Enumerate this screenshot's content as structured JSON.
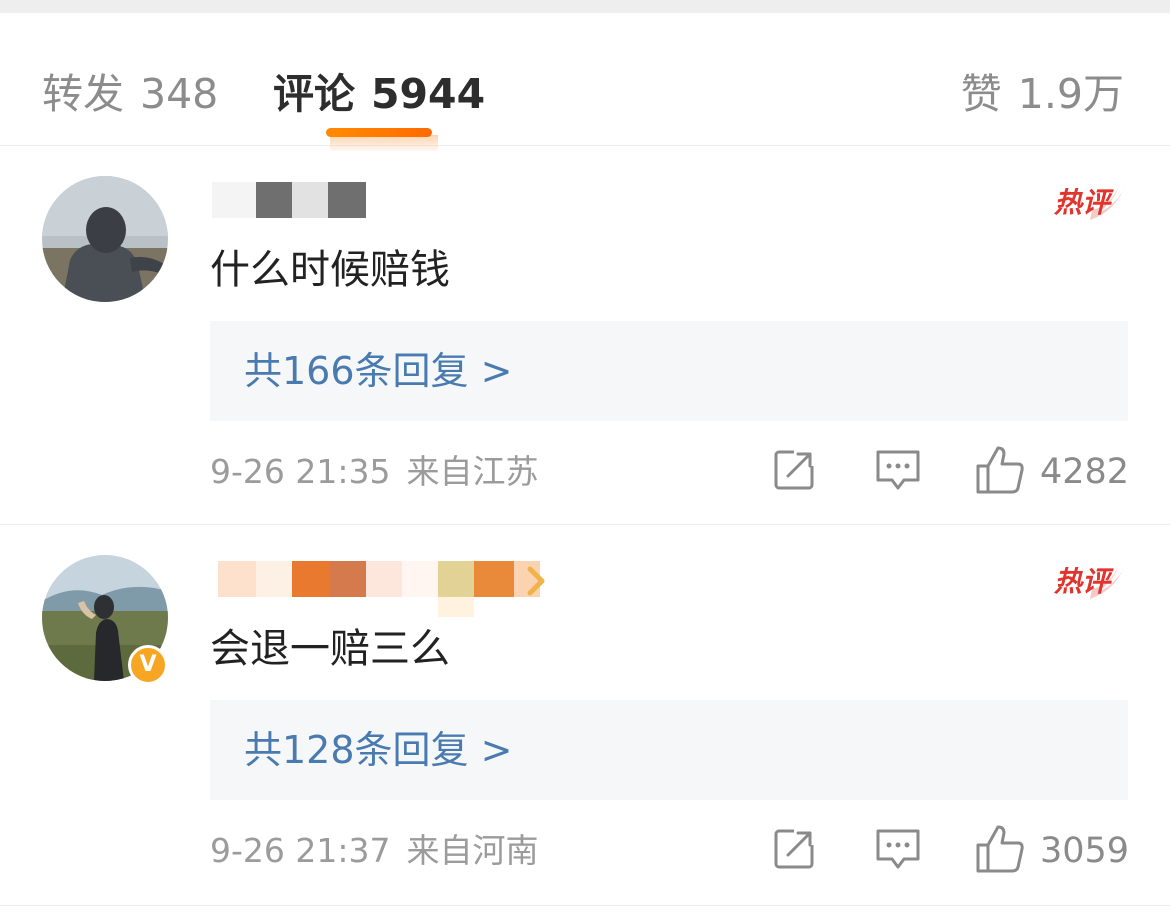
{
  "tabs": {
    "repost": {
      "label": "转发",
      "count": "348"
    },
    "comment": {
      "label": "评论",
      "count": "5944"
    },
    "likes": {
      "label": "赞",
      "count": "1.9万"
    }
  },
  "comments": [
    {
      "text": "什么时候赔钱",
      "hot_label": "热评",
      "replies": "共166条回复 >",
      "date": "9-26 21:35",
      "location": "来自江苏",
      "likes": "4282"
    },
    {
      "text": "会退一赔三么",
      "hot_label": "热评",
      "replies": "共128条回复 >",
      "date": "9-26 21:37",
      "location": "来自河南",
      "likes": "3059",
      "verified_badge": "V"
    }
  ],
  "colors": {
    "accent_orange": "#ff7a00",
    "reply_link": "#4a7bb0",
    "hot_red": "#e0342d",
    "muted_text": "#9b9b9b"
  },
  "icons": [
    "share-icon",
    "comment-icon",
    "thumbs-up-icon",
    "verified-icon",
    "hot-comment-icon"
  ]
}
